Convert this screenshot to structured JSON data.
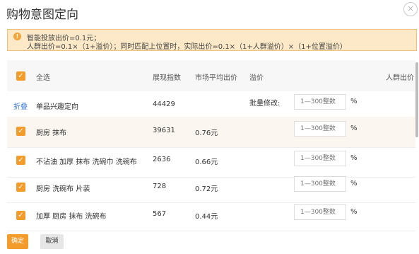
{
  "dialog": {
    "title": "购物意图定向",
    "close_glyph": "×"
  },
  "notice": {
    "icon": "warning-icon",
    "icon_glyph": "!",
    "line1": "智能投放出价=0.1元；",
    "line2": "人群出价=0.1×（1+溢价）；同时匹配上位置时，实际出价=0.1×（1+人群溢价）×（1+位置溢价）"
  },
  "table": {
    "headers": {
      "select_all": "全选",
      "index": "展现指数",
      "avg_price": "市场平均出价",
      "premium": "溢价",
      "crowd_price": "人群出价"
    },
    "group": {
      "fold": "折叠",
      "name": "单品兴趣定向",
      "index": "44429",
      "batch_label": "批量修改:",
      "placeholder": "1—300整数",
      "unit": "%"
    },
    "rows": [
      {
        "name": "厨房 抹布",
        "index": "39631",
        "avg_price": "0.76元",
        "placeholder": "1—300整数",
        "unit": "%"
      },
      {
        "name": "不沾油 加厚 抹布 洗碗巾 洗碗布",
        "index": "2636",
        "avg_price": "0.66元",
        "placeholder": "1—300整数",
        "unit": "%"
      },
      {
        "name": "厨房 洗碗布 片装",
        "index": "728",
        "avg_price": "0.72元",
        "placeholder": "1—300整数",
        "unit": "%"
      },
      {
        "name": "加厚 厨房 抹布 洗碗布",
        "index": "567",
        "avg_price": "0.44元",
        "placeholder": "1—300整数",
        "unit": "%"
      }
    ]
  },
  "footer": {
    "ok": "确定",
    "cancel": "取消"
  },
  "colors": {
    "accent": "#f39b2b",
    "notice_bg": "#fde9c7",
    "link": "#3b7dd8"
  }
}
